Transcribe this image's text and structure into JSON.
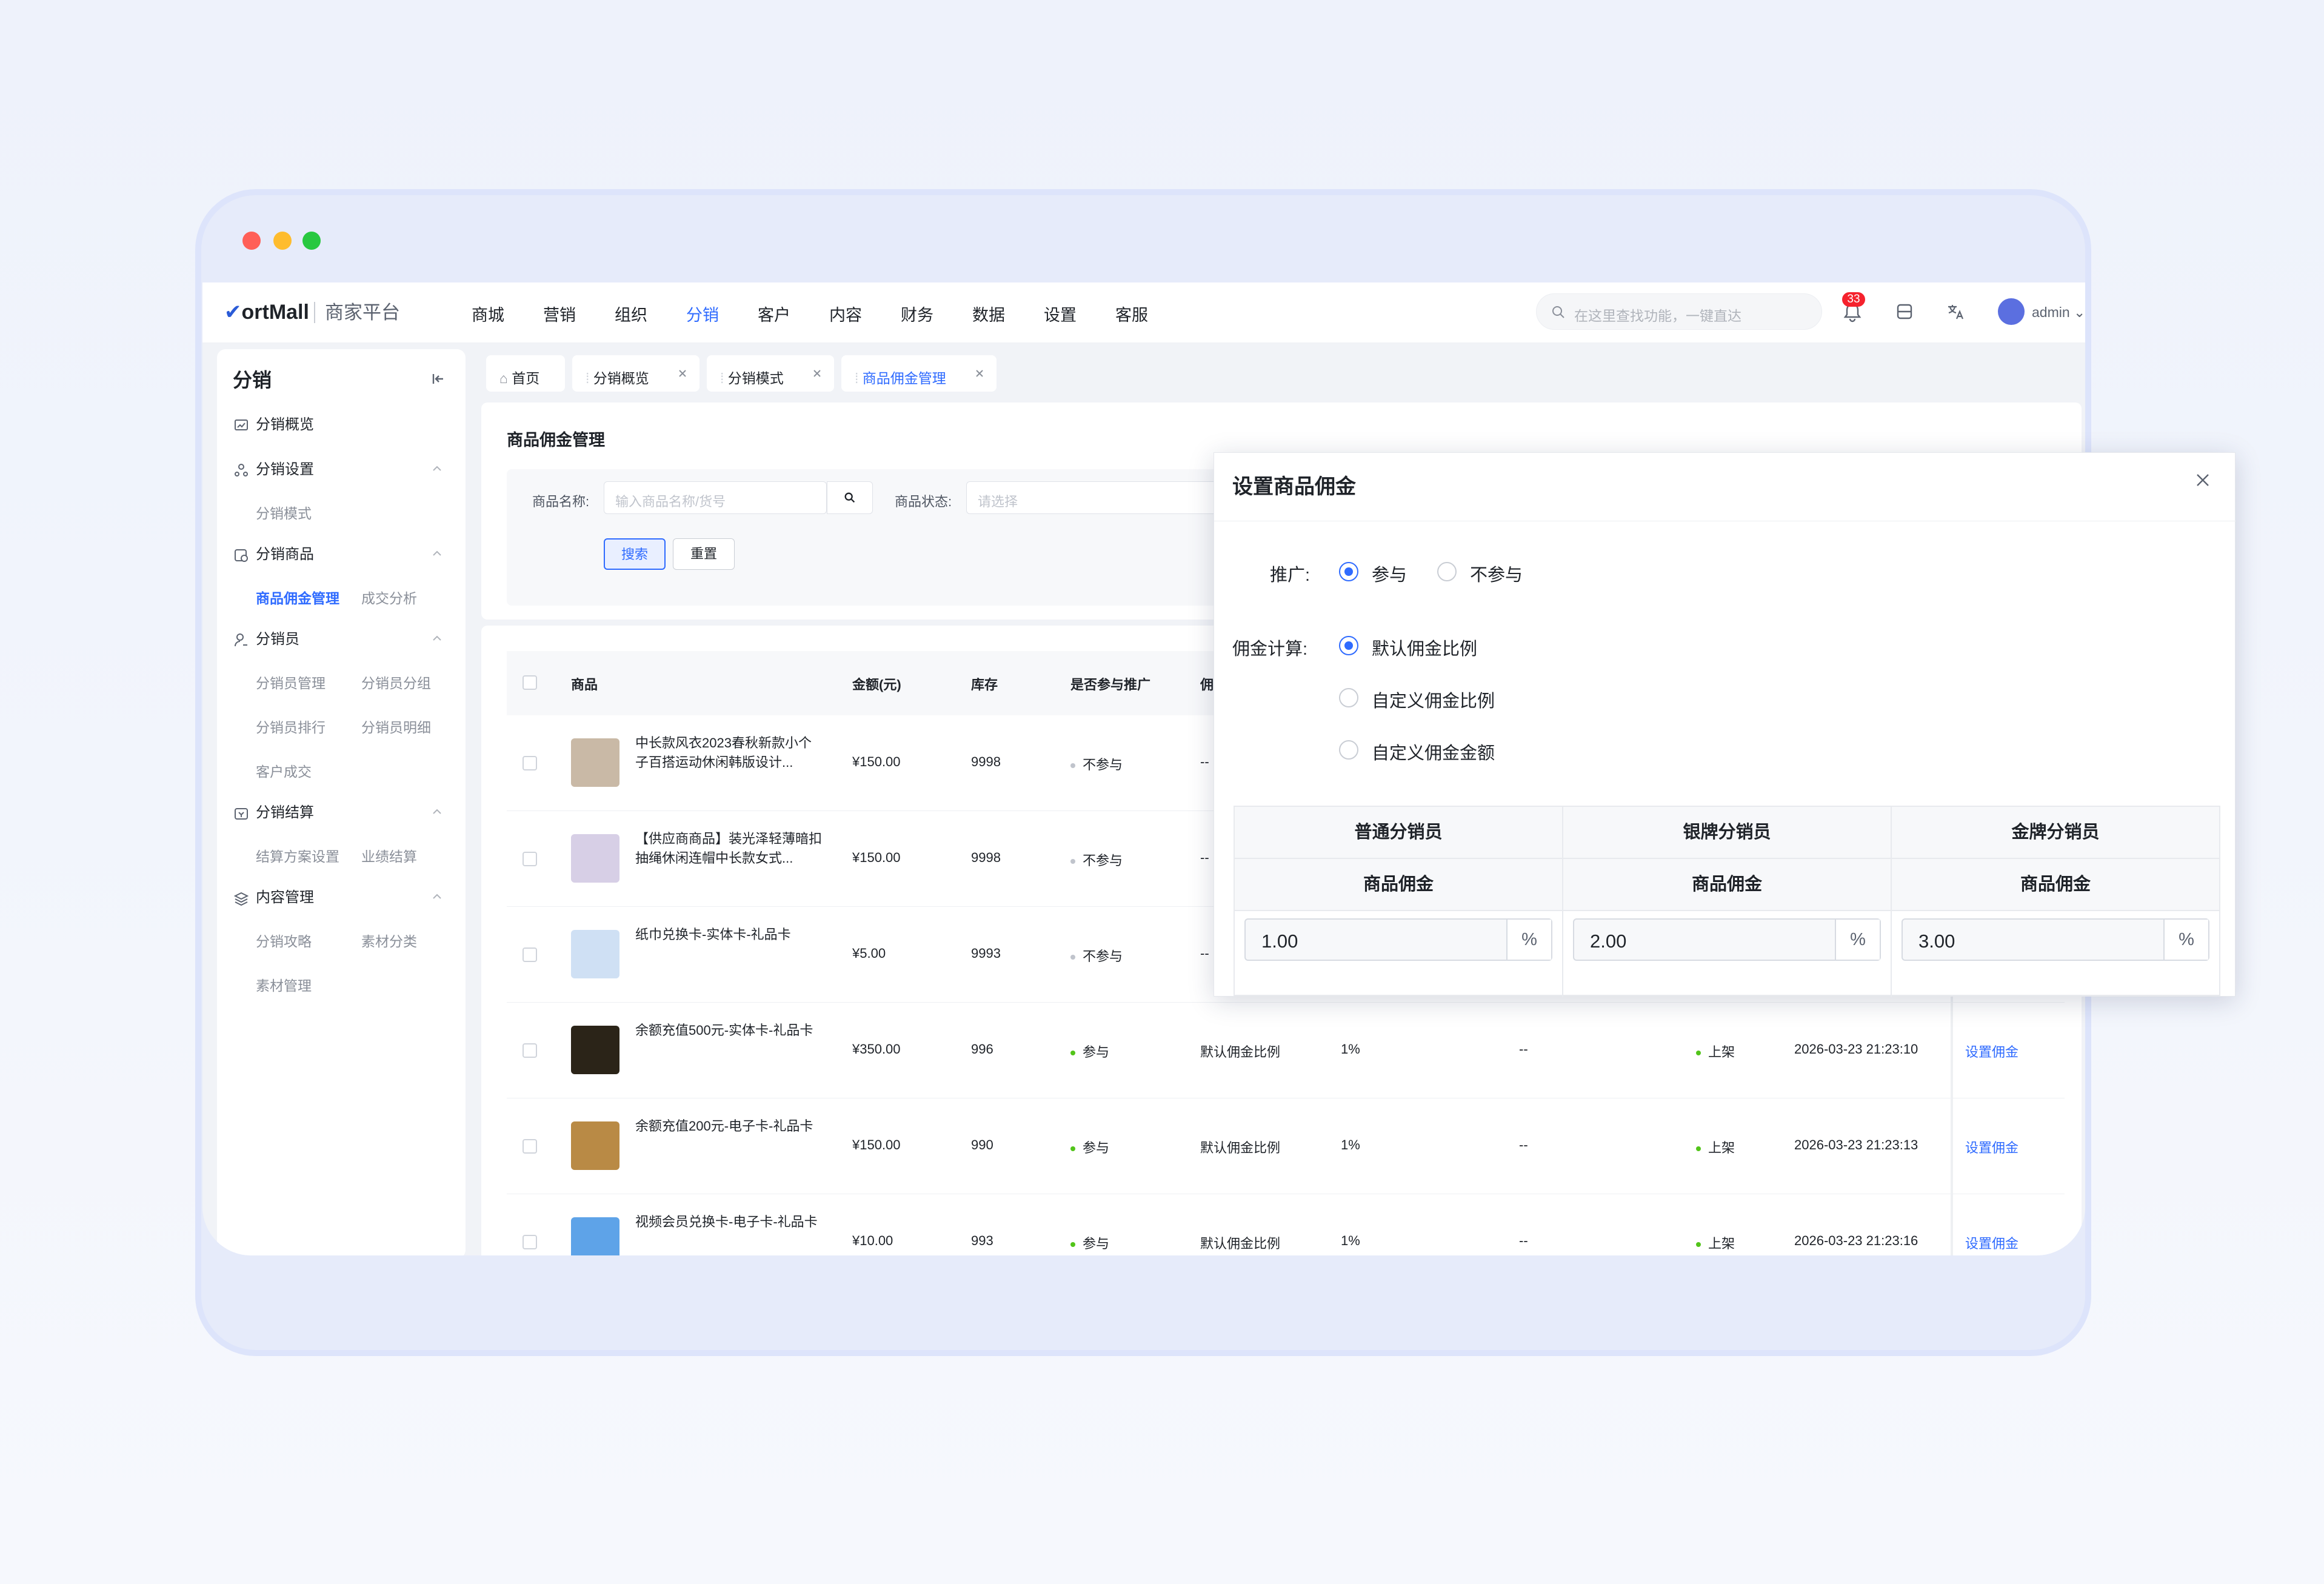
{
  "app": {
    "logo_main": "ortMall",
    "logo_sub": "商家平台"
  },
  "topnav": [
    "商城",
    "营销",
    "组织",
    "分销",
    "客户",
    "内容",
    "财务",
    "数据",
    "设置",
    "客服"
  ],
  "topnav_active": "分销",
  "search_placeholder": "在这里查找功能，一键直达",
  "notification_count": "33",
  "user": "admin",
  "sidebar": {
    "title": "分销",
    "groups": [
      {
        "label": "分销概览",
        "icon": "dashboard-icon"
      },
      {
        "label": "分销设置",
        "icon": "share-icon",
        "items": [
          "分销模式"
        ]
      },
      {
        "label": "分销商品",
        "icon": "goods-icon",
        "items": [
          "商品佣金管理",
          "成交分析"
        ]
      },
      {
        "label": "分销员",
        "icon": "user-icon",
        "items": [
          "分销员管理",
          "分销员分组",
          "分销员排行",
          "分销员明细",
          "客户成交"
        ]
      },
      {
        "label": "分销结算",
        "icon": "settle-icon",
        "items": [
          "结算方案设置",
          "业绩结算"
        ]
      },
      {
        "label": "内容管理",
        "icon": "layers-icon",
        "items": [
          "分销攻略",
          "素材分类",
          "素材管理"
        ]
      }
    ],
    "active_item": "商品佣金管理"
  },
  "tabs": [
    {
      "label": "首页",
      "icon": "home-icon"
    },
    {
      "label": "分销概览"
    },
    {
      "label": "分销模式"
    },
    {
      "label": "商品佣金管理",
      "active": true
    }
  ],
  "page": {
    "title": "商品佣金管理",
    "filter": {
      "name_label": "商品名称:",
      "name_placeholder": "输入商品名称/货号",
      "status_label": "商品状态:",
      "status_placeholder": "请选择",
      "search_btn": "搜索",
      "reset_btn": "重置"
    }
  },
  "table": {
    "headers": [
      "商品",
      "金额(元)",
      "库存",
      "是否参与推广",
      "佣"
    ],
    "rows": [
      {
        "name": "中长款风衣2023春秋新款小个子百搭运动休闲韩版设计...",
        "price": "¥150.00",
        "stock": "9998",
        "promote": "不参与",
        "calc": "--",
        "ratio": "",
        "amount": "",
        "status": "",
        "time": "",
        "action": ""
      },
      {
        "name": "【供应商商品】装光泽轻薄暗扣抽绳休闲连帽中长款女式...",
        "price": "¥150.00",
        "stock": "9998",
        "promote": "不参与",
        "calc": "--",
        "ratio": "",
        "amount": "",
        "status": "",
        "time": "",
        "action": ""
      },
      {
        "name": "纸巾兑换卡-实体卡-礼品卡",
        "price": "¥5.00",
        "stock": "9993",
        "promote": "不参与",
        "calc": "--",
        "ratio": "",
        "amount": "",
        "status": "",
        "time": "",
        "action": ""
      },
      {
        "name": "余额充值500元-实体卡-礼品卡",
        "price": "¥350.00",
        "stock": "996",
        "promote": "参与",
        "calc": "默认佣金比例",
        "ratio": "1%",
        "amount": "--",
        "status": "上架",
        "time": "2026-03-23 21:23:10",
        "action": "设置佣金"
      },
      {
        "name": "余额充值200元-电子卡-礼品卡",
        "price": "¥150.00",
        "stock": "990",
        "promote": "参与",
        "calc": "默认佣金比例",
        "ratio": "1%",
        "amount": "--",
        "status": "上架",
        "time": "2026-03-23 21:23:13",
        "action": "设置佣金"
      },
      {
        "name": "视频会员兑换卡-电子卡-礼品卡",
        "price": "¥10.00",
        "stock": "993",
        "promote": "参与",
        "calc": "默认佣金比例",
        "ratio": "1%",
        "amount": "--",
        "status": "上架",
        "time": "2026-03-23 21:23:16",
        "action": "设置佣金"
      }
    ]
  },
  "modal": {
    "title": "设置商品佣金",
    "promote_label": "推广:",
    "promote_options": [
      "参与",
      "不参与"
    ],
    "promote_selected": "参与",
    "calc_label": "佣金计算:",
    "calc_options": [
      "默认佣金比例",
      "自定义佣金比例",
      "自定义佣金金额"
    ],
    "calc_selected": "默认佣金比例",
    "levels": [
      {
        "name": "普通分销员",
        "sub": "商品佣金",
        "value": "1.00",
        "unit": "%"
      },
      {
        "name": "银牌分销员",
        "sub": "商品佣金",
        "value": "2.00",
        "unit": "%"
      },
      {
        "name": "金牌分销员",
        "sub": "商品佣金",
        "value": "3.00",
        "unit": "%"
      }
    ]
  },
  "colors": {
    "accent": "#2f6bff",
    "success": "#52c41a",
    "neutral_dot": "#c0c4cc",
    "badge": "#f5222d"
  }
}
